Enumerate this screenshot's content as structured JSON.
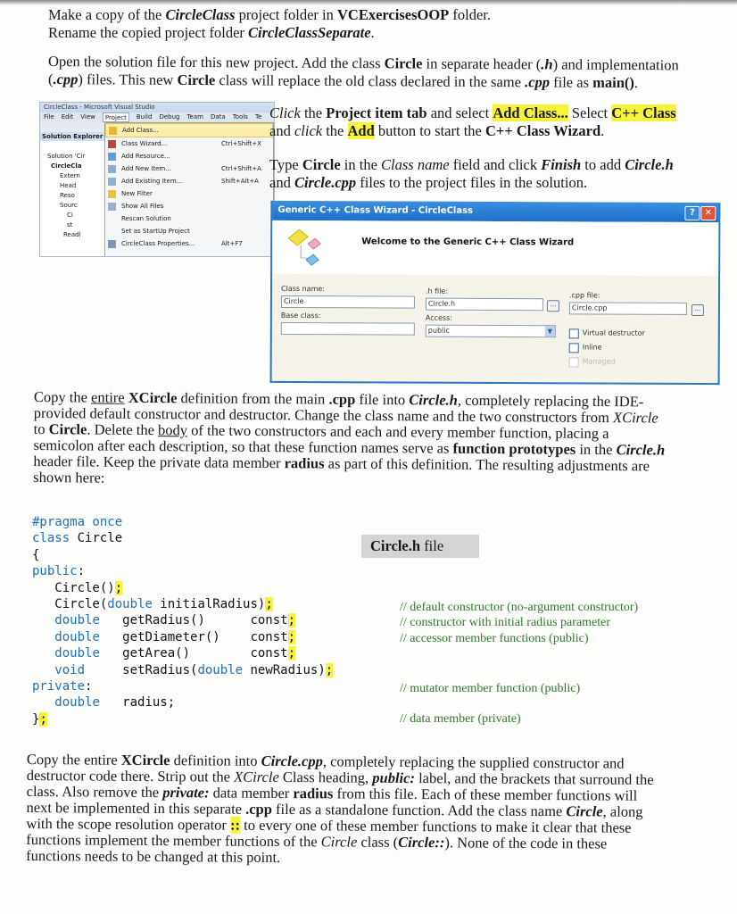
{
  "intro": {
    "line1": [
      "Make a copy of the ",
      "CircleClass",
      " project folder in ",
      "VCExercisesOOP",
      " folder."
    ],
    "line2": [
      "Rename the copied project folder ",
      "CircleClassSeparate",
      "."
    ],
    "para2_line1": [
      "Open the solution file for this new project.  Add the class ",
      "Circle",
      " in separate header (",
      ".h",
      ") and implementation"
    ],
    "para2_line2": [
      "(",
      ".cpp",
      ") files. This new ",
      "Circle",
      " class will replace the old class declared in the same ",
      ".cpp",
      " file as ",
      "main()",
      "."
    ]
  },
  "vs_screenshot": {
    "title": "CircleClass - Microsoft Visual Studio",
    "menubar": [
      "File",
      "Edit",
      "View",
      "Project",
      "Build",
      "Debug",
      "Team",
      "Data",
      "Tools",
      "Te"
    ],
    "active_menu": "Project",
    "solution_explorer": {
      "header": "Solution Explorer",
      "items": [
        "Solution 'Cir",
        "CircleCla",
        "Extern",
        "Head",
        "Reso",
        "Sourc",
        "Ci",
        "st",
        "Readl"
      ]
    },
    "project_menu": [
      {
        "label": "Add Class...",
        "shortcut": "",
        "selected": true
      },
      {
        "label": "Class Wizard...",
        "shortcut": "Ctrl+Shift+X"
      },
      {
        "label": "Add Resource...",
        "shortcut": ""
      },
      {
        "label": "Add New Item...",
        "shortcut": "Ctrl+Shift+A"
      },
      {
        "label": "Add Existing Item...",
        "shortcut": "Shift+Alt+A"
      },
      {
        "label": "New Filter",
        "shortcut": ""
      },
      {
        "label": "Show All Files",
        "shortcut": ""
      },
      {
        "label": "Rescan Solution",
        "shortcut": ""
      },
      {
        "label": "Set as StartUp Project",
        "shortcut": ""
      },
      {
        "label": "CircleClass Properties...",
        "shortcut": "Alt+F7"
      }
    ]
  },
  "instr_right": {
    "p1": [
      "Click",
      " the ",
      "Project item tab",
      " and select ",
      "Add Class...",
      "  Select ",
      "C++ Class"
    ],
    "p1b": [
      "and ",
      "click",
      " the ",
      "Add",
      " button to start the ",
      "C++ Class Wizard",
      "."
    ],
    "p2": [
      "Type ",
      "Circle",
      " in the ",
      "Class name",
      " field and click ",
      "Finish",
      " to add ",
      "Circle.h"
    ],
    "p2b": [
      "and ",
      "Circle.cpp",
      " files to the project files in the solution."
    ]
  },
  "wizard": {
    "title": "Generic C++ Class Wizard - CircleClass",
    "help": "?",
    "close": "✕",
    "welcome": "Welcome to the Generic C++ Class Wizard",
    "class_name_label": "Class name:",
    "class_name_value": "Circle",
    "h_file_label": ".h file:",
    "h_file_value": "Circle.h",
    "cpp_file_label": ".cpp file:",
    "cpp_file_value": "Circle.cpp",
    "base_class_label": "Base class:",
    "base_class_value": "",
    "access_label": "Access:",
    "access_value": "public",
    "browse": "...",
    "virtual_destructor": "Virtual destructor",
    "inline": "Inline",
    "managed": "Managed"
  },
  "para3": {
    "l1": [
      "Copy the ",
      "entire",
      " ",
      "XCircle",
      " definition from the main ",
      ".cpp",
      " file into ",
      "Circle.h",
      ", completely replacing the IDE-"
    ],
    "l2": "provided default constructor and destructor.  Change the class name and the two constructors from ",
    "l2i": "XCircle",
    "l3": [
      "to ",
      "Circle",
      ".  Delete the ",
      "body",
      " of the two constructors and each and every member function, placing a"
    ],
    "l4": "semicolon after each description, so that these function names serve as ",
    "l4b": "function prototypes",
    "l4c": " in the ",
    "l4d": "Circle.h",
    "l5": [
      "header file.  Keep the private data member ",
      "radius",
      " as part of this definition.  The resulting adjustments are"
    ],
    "l6": "shown here:"
  },
  "code": {
    "lines": [
      "#pragma once",
      "class Circle",
      "{",
      "public:",
      "Circle();",
      "Circle(double initialRadius);",
      "double getRadius() const;",
      "double getDiameter() const;",
      "double getArea() const;",
      "void setRadius(double newRadius);",
      "private:",
      "double radius;",
      "};"
    ]
  },
  "file_tag": {
    "name": "Circle.h",
    "suffix": " file"
  },
  "comments": [
    "// default constructor (no-argument constructor)",
    "// constructor with initial radius parameter",
    "// accessor member functions  (public)",
    "// mutator member function (public)",
    "// data member (private)"
  ],
  "para4": {
    "l1": [
      "Copy the entire ",
      "XCircle",
      " definition into ",
      "Circle.cpp",
      ", completely replacing the supplied constructor and"
    ],
    "l2": [
      "destructor code there.  Strip out the ",
      "XCircle",
      " Class heading, ",
      "public:",
      " label, and the brackets that surround the"
    ],
    "l3": [
      "class.  Also remove the ",
      "private:",
      "  data member ",
      "radius",
      " from this file.  Each of these member functions will"
    ],
    "l4": [
      "next be implemented in this separate ",
      ".cpp",
      " file as a standalone function.  Add the class name ",
      "Circle",
      ", along"
    ],
    "l5": [
      "with the scope resolution operator ",
      "::",
      " to every one of these member functions to make it clear that these"
    ],
    "l6": [
      "functions implement the member functions of the ",
      "Circle",
      " class (",
      "Circle::",
      ").  None of the code in these"
    ],
    "l7": "functions needs to be changed at this point."
  },
  "colors": {
    "highlight": "#f7f23a",
    "keyword": "#1f6fb8",
    "comment": "#2e7a2a",
    "wizard_title": "#1f6fc9"
  }
}
